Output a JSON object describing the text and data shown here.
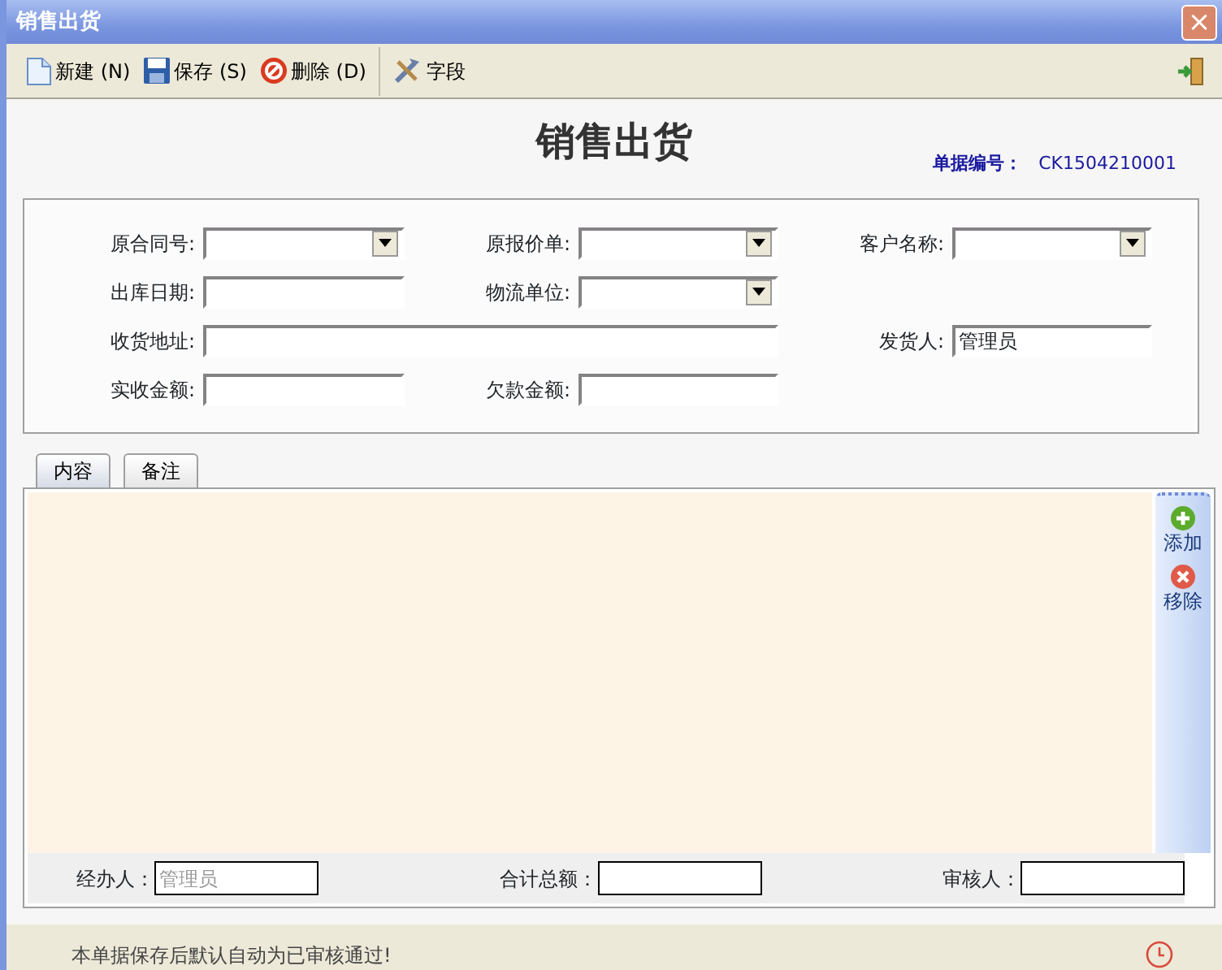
{
  "window": {
    "title": "销售出货",
    "close": "×"
  },
  "toolbar": [
    {
      "label": "新建",
      "shortcut": "(N)"
    },
    {
      "label": "保存",
      "shortcut": "(S)"
    },
    {
      "label": "删除",
      "shortcut": "(D)"
    },
    {
      "label": "字段"
    }
  ],
  "heading": "销售出货",
  "doc_number": {
    "label": "单据编号：",
    "value": "CK1504210001"
  },
  "form": [
    [
      {
        "label": "原合同号:",
        "kind": "combo"
      },
      {
        "label": "原报价单:",
        "kind": "combo"
      },
      {
        "label": "客户名称:",
        "kind": "combo"
      }
    ],
    [
      {
        "label": "出库日期:",
        "kind": "text"
      },
      {
        "label": "物流单位:",
        "kind": "combo"
      }
    ],
    [
      {
        "label": "收货地址:",
        "kind": "wide_text"
      },
      {
        "label": "发货人:",
        "kind": "text",
        "value": "管理员"
      }
    ],
    [
      {
        "label": "实收金额:",
        "kind": "text"
      },
      {
        "label": "欠款金额:",
        "kind": "text"
      }
    ]
  ],
  "tabs": [
    {
      "label": "内容",
      "selected": true
    },
    {
      "label": "备注",
      "selected": false
    }
  ],
  "side_actions": [
    {
      "label": "添加"
    },
    {
      "label": "移除"
    }
  ],
  "footer_fields": [
    {
      "label": "经办人：",
      "placeholder": "管理员"
    },
    {
      "label": "合计总额："
    },
    {
      "label": "审核人："
    }
  ],
  "status_note": "本单据保存后默认自动为已审核通过!"
}
